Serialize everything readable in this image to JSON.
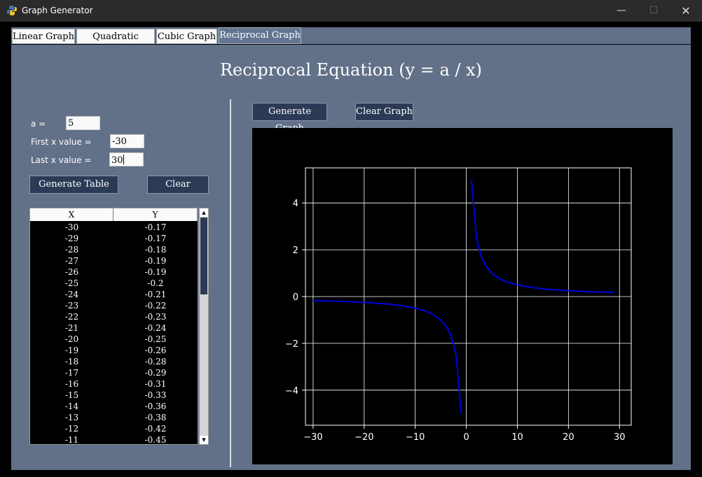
{
  "window": {
    "title": "Graph Generator"
  },
  "tabs": [
    {
      "label": "Linear Graph"
    },
    {
      "label": "Quadratic Graph"
    },
    {
      "label": "Cubic Graph"
    },
    {
      "label": "Reciprocal Graph",
      "active": true
    }
  ],
  "page": {
    "heading": "Reciprocal Equation (y = a / x)"
  },
  "form": {
    "a_label": "a =",
    "a_value": "5",
    "first_label": "First x value =",
    "first_value": "-30",
    "last_label": "Last x value =",
    "last_value": "30"
  },
  "buttons": {
    "generate_table": "Generate Table",
    "clear": "Clear",
    "generate_graph": "Generate Graph",
    "clear_graph": "Clear Graph"
  },
  "table": {
    "columns": [
      "X",
      "Y"
    ],
    "rows": [
      [
        "-30",
        "-0.17"
      ],
      [
        "-29",
        "-0.17"
      ],
      [
        "-28",
        "-0.18"
      ],
      [
        "-27",
        "-0.19"
      ],
      [
        "-26",
        "-0.19"
      ],
      [
        "-25",
        "-0.2"
      ],
      [
        "-24",
        "-0.21"
      ],
      [
        "-23",
        "-0.22"
      ],
      [
        "-22",
        "-0.23"
      ],
      [
        "-21",
        "-0.24"
      ],
      [
        "-20",
        "-0.25"
      ],
      [
        "-19",
        "-0.26"
      ],
      [
        "-18",
        "-0.28"
      ],
      [
        "-17",
        "-0.29"
      ],
      [
        "-16",
        "-0.31"
      ],
      [
        "-15",
        "-0.33"
      ],
      [
        "-14",
        "-0.36"
      ],
      [
        "-13",
        "-0.38"
      ],
      [
        "-12",
        "-0.42"
      ],
      [
        "-11",
        "-0.45"
      ]
    ]
  },
  "colors": {
    "panel": "#627088",
    "button": "#2c3a56",
    "curve": "#0000e0"
  },
  "chart_data": {
    "type": "line",
    "xlim": [
      -31.5,
      32.3
    ],
    "ylim": [
      -5.5,
      5.5
    ],
    "xticks": [
      -30,
      -20,
      -10,
      0,
      10,
      20,
      30
    ],
    "yticks": [
      -4,
      -2,
      0,
      2,
      4
    ],
    "grid": true,
    "series": [
      {
        "x": [
          -30,
          -29,
          -28,
          -27,
          -26,
          -25,
          -24,
          -23,
          -22,
          -21,
          -20,
          -19,
          -18,
          -17,
          -16,
          -15,
          -14,
          -13,
          -12,
          -11,
          -10,
          -9,
          -8,
          -7,
          -6,
          -5,
          -4,
          -3,
          -2,
          -1
        ],
        "y": [
          -0.17,
          -0.17,
          -0.18,
          -0.19,
          -0.19,
          -0.2,
          -0.21,
          -0.22,
          -0.23,
          -0.24,
          -0.25,
          -0.26,
          -0.28,
          -0.29,
          -0.31,
          -0.33,
          -0.36,
          -0.38,
          -0.42,
          -0.45,
          -0.5,
          -0.56,
          -0.62,
          -0.71,
          -0.83,
          -1.0,
          -1.25,
          -1.67,
          -2.5,
          -5.0
        ]
      },
      {
        "x": [
          1,
          2,
          3,
          4,
          5,
          6,
          7,
          8,
          9,
          10,
          11,
          12,
          13,
          14,
          15,
          16,
          17,
          18,
          19,
          20,
          21,
          22,
          23,
          24,
          25,
          26,
          27,
          28,
          29
        ],
        "y": [
          5.0,
          2.5,
          1.67,
          1.25,
          1.0,
          0.83,
          0.71,
          0.62,
          0.56,
          0.5,
          0.45,
          0.42,
          0.38,
          0.36,
          0.33,
          0.31,
          0.29,
          0.28,
          0.26,
          0.25,
          0.24,
          0.23,
          0.22,
          0.21,
          0.2,
          0.19,
          0.19,
          0.18,
          0.17
        ]
      }
    ]
  }
}
